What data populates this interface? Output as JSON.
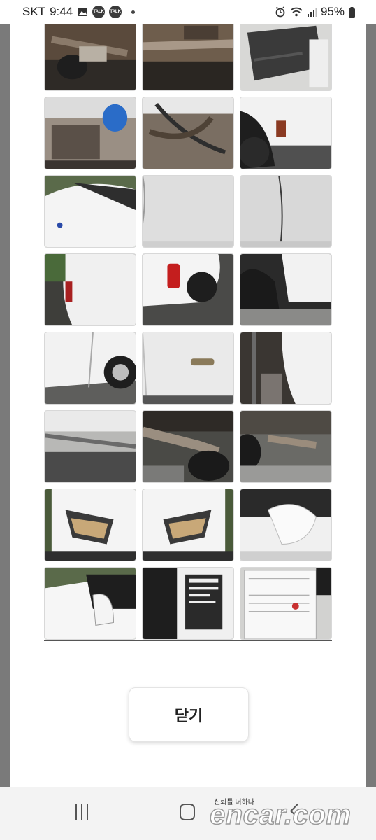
{
  "status_bar": {
    "carrier": "SKT",
    "time": "9:44",
    "notification_icons": [
      "gallery-icon",
      "kakaotalk-icon",
      "kakaotalk-icon",
      "dot-icon"
    ],
    "talk_label": "TALK",
    "system_icons": [
      "alarm-icon",
      "wifi-icon",
      "signal-icon",
      "battery-icon"
    ],
    "battery": "95%"
  },
  "photos": [
    {
      "subject": "undercarriage-axle"
    },
    {
      "subject": "undercarriage-frame"
    },
    {
      "subject": "underbody-panel"
    },
    {
      "subject": "engine-bay-reservoir"
    },
    {
      "subject": "undercarriage-hoses"
    },
    {
      "subject": "wheel-arch-rust"
    },
    {
      "subject": "front-hood-bumper"
    },
    {
      "subject": "door-panel"
    },
    {
      "subject": "door-seam"
    },
    {
      "subject": "rear-quarter"
    },
    {
      "subject": "rear-taillight"
    },
    {
      "subject": "rear-wheel-arch"
    },
    {
      "subject": "side-door-wheel"
    },
    {
      "subject": "fuel-door"
    },
    {
      "subject": "wheel-well-inner"
    },
    {
      "subject": "side-skirt"
    },
    {
      "subject": "exhaust-pipe"
    },
    {
      "subject": "rear-underside"
    },
    {
      "subject": "headlight-left"
    },
    {
      "subject": "headlight-right"
    },
    {
      "subject": "side-mirror"
    },
    {
      "subject": "front-quarter"
    },
    {
      "subject": "door-jamb-label"
    },
    {
      "subject": "inspection-document"
    }
  ],
  "close_button": {
    "label": "닫기"
  },
  "watermark": {
    "tagline": "신뢰를 더하다",
    "brand": "encar.com"
  },
  "nav_bar": {
    "icons": [
      "recents-icon",
      "home-icon",
      "back-icon"
    ]
  }
}
